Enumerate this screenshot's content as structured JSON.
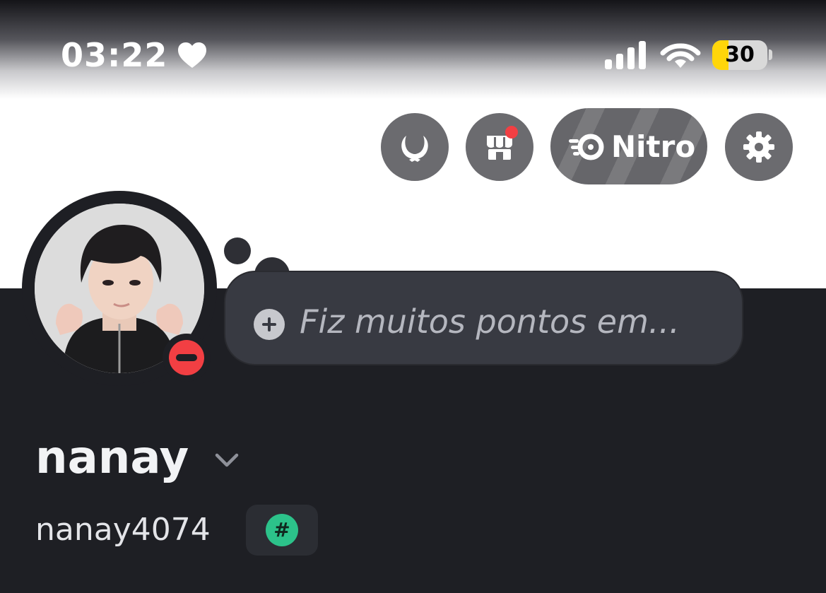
{
  "status_bar": {
    "time": "03:22",
    "focus_icon": "heart-icon",
    "signal_icon": "cellular-signal-icon",
    "wifi_icon": "wifi-icon",
    "battery_level": "30",
    "battery_fraction": 0.3,
    "battery_color": "#ffd60a"
  },
  "header": {
    "buttons": [
      {
        "icon": "laurel-wreath-icon"
      },
      {
        "icon": "shop-icon",
        "notification_dot": "#f23f43"
      },
      {
        "icon": "nitro-icon",
        "label": "Nitro"
      },
      {
        "icon": "gear-icon"
      }
    ]
  },
  "profile": {
    "avatar_status": "do-not-disturb",
    "status_color": "#f23f43",
    "custom_status_placeholder": "Fiz muitos pontos em...",
    "display_name": "nanay",
    "username": "nanay4074",
    "badge_symbol": "#",
    "badge_color": "#2cc28a"
  },
  "colors": {
    "dark_background": "#1e1f24",
    "bubble_background": "#383a42",
    "button_background": "#6b6b6f"
  }
}
